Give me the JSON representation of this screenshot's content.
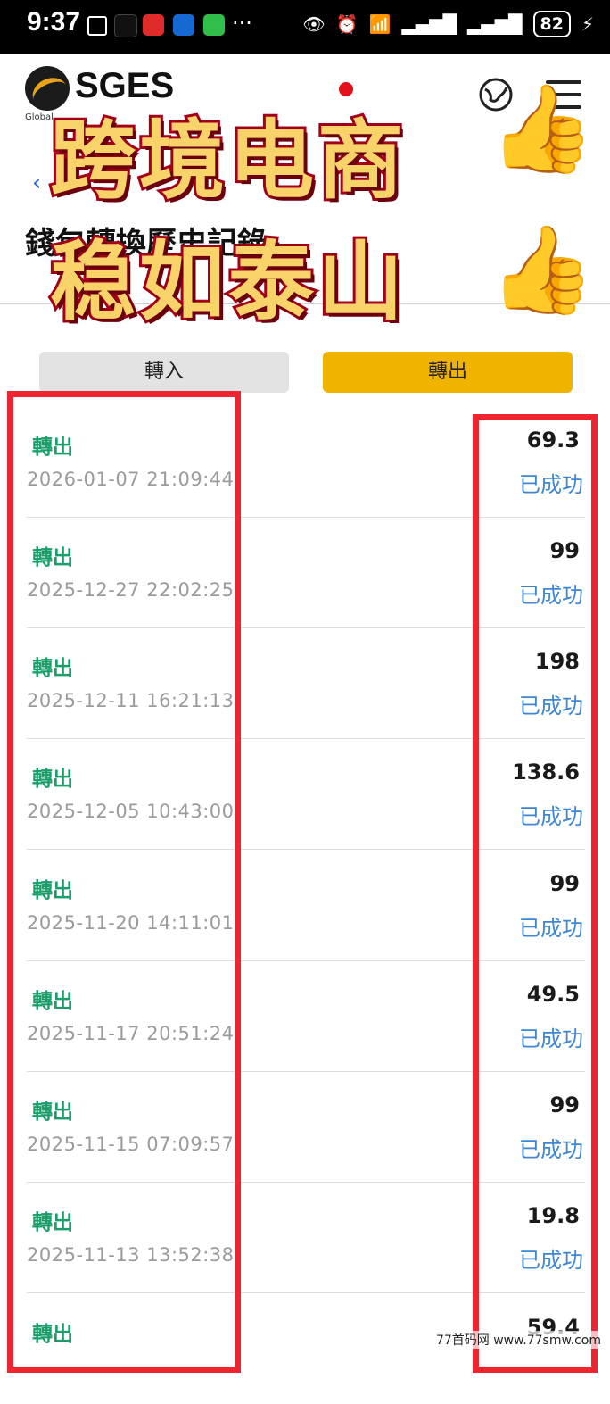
{
  "status_bar": {
    "time": "9:37",
    "battery": "82",
    "network": "6"
  },
  "header": {
    "logo_text": "SGES",
    "logo_sub": "Global"
  },
  "page": {
    "title": "錢包轉換歷史記錄"
  },
  "banner": {
    "line1": "跨境电商",
    "line2": "稳如泰山",
    "emoji": "👍"
  },
  "tabs": [
    {
      "label": "轉入",
      "active": false
    },
    {
      "label": "轉出",
      "active": true
    }
  ],
  "records": [
    {
      "type": "轉出",
      "time": "2026-01-07 21:09:44",
      "amount": "69.3",
      "status": "已成功"
    },
    {
      "type": "轉出",
      "time": "2025-12-27 22:02:25",
      "amount": "99",
      "status": "已成功"
    },
    {
      "type": "轉出",
      "time": "2025-12-11 16:21:13",
      "amount": "198",
      "status": "已成功"
    },
    {
      "type": "轉出",
      "time": "2025-12-05 10:43:00",
      "amount": "138.6",
      "status": "已成功"
    },
    {
      "type": "轉出",
      "time": "2025-11-20 14:11:01",
      "amount": "99",
      "status": "已成功"
    },
    {
      "type": "轉出",
      "time": "2025-11-17 20:51:24",
      "amount": "49.5",
      "status": "已成功"
    },
    {
      "type": "轉出",
      "time": "2025-11-15 07:09:57",
      "amount": "99",
      "status": "已成功"
    },
    {
      "type": "轉出",
      "time": "2025-11-13 13:52:38",
      "amount": "19.8",
      "status": "已成功"
    },
    {
      "type": "轉出",
      "time": "",
      "amount": "59.4",
      "status": ""
    }
  ],
  "watermark": "77首码网 www.77smw.com",
  "colors": {
    "accent_tab": "#f0b400",
    "type_green": "#1a9f6a",
    "status_blue": "#3f86d6",
    "highlight_red": "#ee2530"
  }
}
